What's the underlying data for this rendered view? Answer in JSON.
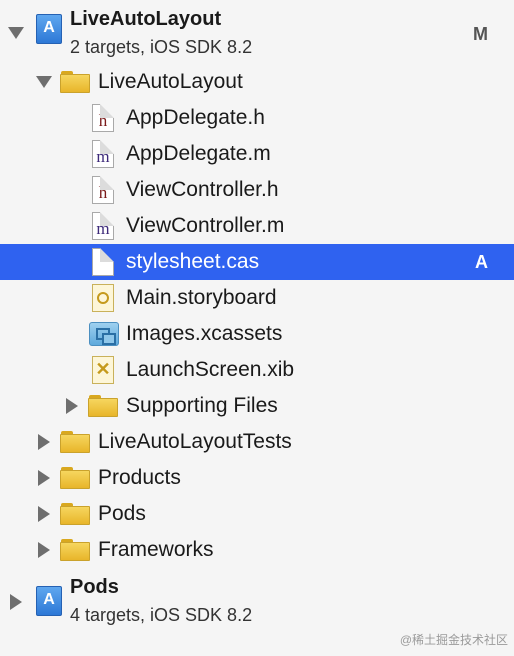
{
  "tree": {
    "project": {
      "name": "LiveAutoLayout",
      "subtitle": "2 targets, iOS SDK 8.2",
      "badge": "M"
    },
    "group": {
      "name": "LiveAutoLayout"
    },
    "files": [
      {
        "name": "AppDelegate.h"
      },
      {
        "name": "AppDelegate.m"
      },
      {
        "name": "ViewController.h"
      },
      {
        "name": "ViewController.m"
      },
      {
        "name": "stylesheet.cas",
        "badge": "A"
      },
      {
        "name": "Main.storyboard"
      },
      {
        "name": "Images.xcassets"
      },
      {
        "name": "LaunchScreen.xib"
      },
      {
        "name": "Supporting Files"
      }
    ],
    "folders": [
      {
        "name": "LiveAutoLayoutTests"
      },
      {
        "name": "Products"
      },
      {
        "name": "Pods"
      },
      {
        "name": "Frameworks"
      }
    ],
    "pods_project": {
      "name": "Pods",
      "subtitle": "4 targets, iOS SDK 8.2"
    }
  },
  "watermark": "@稀土掘金技术社区",
  "colors": {
    "selection": "#2f62f0",
    "background": "#f5f5f5"
  }
}
